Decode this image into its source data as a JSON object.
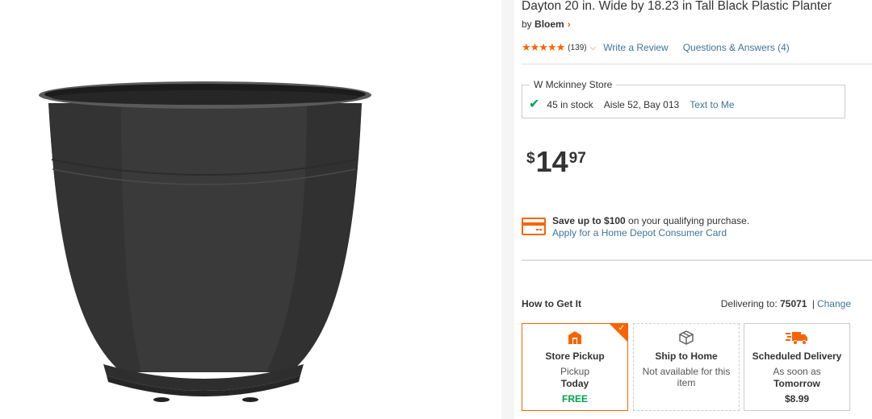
{
  "product": {
    "title": "Dayton 20 in. Wide by 18.23 in Tall Black Plastic Planter",
    "brand_prefix": "by",
    "brand": "Bloem",
    "rating": 4.5,
    "stars": "★★★★★",
    "review_count": "(139)",
    "write_review": "Write a Review",
    "qa": "Questions & Answers (4)"
  },
  "store": {
    "name": "W Mckinney Store",
    "stock": "45 in stock",
    "aisle": "Aisle 52, Bay 013",
    "text_me": "Text to Me"
  },
  "price": {
    "currency": "$",
    "dollars": "14",
    "cents": "97"
  },
  "credit": {
    "line1_pre": "Save up to ",
    "line1_amount": "$100",
    "line1_post": " on your qualifying purchase.",
    "line2": "Apply for a Home Depot Consumer Card"
  },
  "fulfillment": {
    "heading": "How to Get It",
    "delivering_label": "Delivering to:",
    "zip": "75071",
    "separator": "|",
    "change": "Change",
    "pickup": {
      "title": "Store Pickup",
      "line1": "Pickup",
      "line2": "Today",
      "price": "FREE"
    },
    "ship": {
      "title": "Ship to Home",
      "line1": "Not available for this item"
    },
    "scheduled": {
      "title": "Scheduled Delivery",
      "line1": "As soon as",
      "line2": "Tomorrow",
      "price": "$8.99"
    }
  },
  "colors": {
    "accent": "#f96302",
    "link": "#3e7697",
    "success": "#00a34a",
    "planter": "#3b3b3b"
  },
  "icons": [
    "chevron-right-icon",
    "star-icon",
    "chevron-down-icon",
    "check-icon",
    "credit-card-icon",
    "store-pickup-icon",
    "box-icon",
    "truck-icon"
  ]
}
